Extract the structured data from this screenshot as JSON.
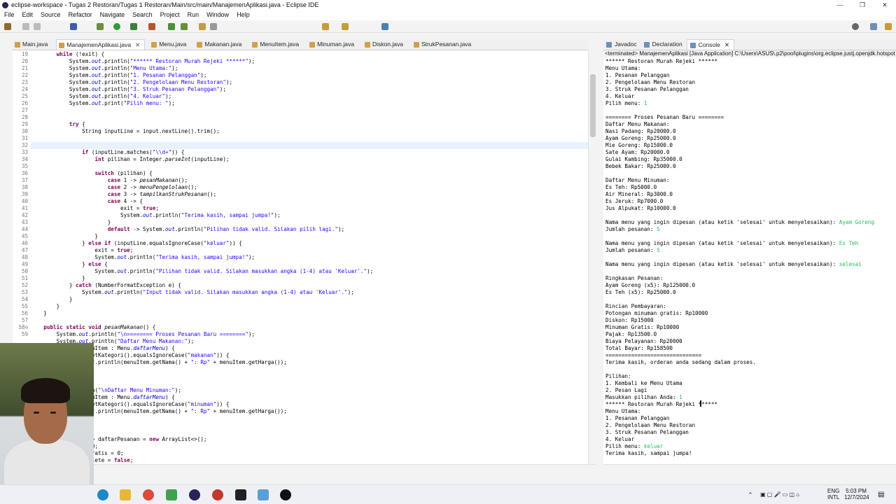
{
  "window": {
    "title": "eclipse-workspace - Tugas 2 Restoran/Tugas 1 Restoran/Main/src/main/ManajemenAplikasi.java - Eclipse IDE",
    "controls": [
      "—",
      "❐",
      "✕"
    ]
  },
  "menubar": [
    "File",
    "Edit",
    "Source",
    "Refactor",
    "Navigate",
    "Search",
    "Project",
    "Run",
    "Window",
    "Help"
  ],
  "editor_tabs": [
    {
      "label": "Main.java",
      "active": false
    },
    {
      "label": "ManajemenAplikasi.java",
      "active": true
    },
    {
      "label": "Menu.java",
      "active": false
    },
    {
      "label": "Makanan.java",
      "active": false
    },
    {
      "label": "MenuItem.java",
      "active": false
    },
    {
      "label": "Minuman.java",
      "active": false
    },
    {
      "label": "Diskon.java",
      "active": false
    },
    {
      "label": "StrukPesanan.java",
      "active": false
    }
  ],
  "code_lines": [
    {
      "n": "19",
      "t": "        while (!exit) {"
    },
    {
      "n": "20",
      "t": "            System.out.println(\"****** Restoran Murah Rejeki ******\");"
    },
    {
      "n": "21",
      "t": "            System.out.println(\"Menu Utama:\");"
    },
    {
      "n": "22",
      "t": "            System.out.println(\"1. Pesanan Pelanggan\");"
    },
    {
      "n": "23",
      "t": "            System.out.println(\"2. Pengelolaan Menu Restoran\");"
    },
    {
      "n": "24",
      "t": "            System.out.println(\"3. Struk Pesanan Pelanggan\");"
    },
    {
      "n": "25",
      "t": "            System.out.println(\"4. Keluar\");"
    },
    {
      "n": "26",
      "t": "            System.out.print(\"Pilih menu: \");"
    },
    {
      "n": "27",
      "t": ""
    },
    {
      "n": "28",
      "t": ""
    },
    {
      "n": "29",
      "t": "            try {"
    },
    {
      "n": "30",
      "t": "                String inputLine = input.nextLine().trim();"
    },
    {
      "n": "31",
      "t": ""
    },
    {
      "n": "32",
      "t": ""
    },
    {
      "n": "33",
      "t": "                if (inputLine.matches(\"\\\\d+\")) {"
    },
    {
      "n": "34",
      "t": "                    int pilihan = Integer.parseInt(inputLine);"
    },
    {
      "n": "35",
      "t": ""
    },
    {
      "n": "36",
      "t": "                    switch (pilihan) {"
    },
    {
      "n": "37",
      "t": "                        case 1 -> pesanMakanan();"
    },
    {
      "n": "38",
      "t": "                        case 2 -> menuPengelolaan();"
    },
    {
      "n": "39",
      "t": "                        case 3 -> tampilkanStrukPesanan();"
    },
    {
      "n": "40",
      "t": "                        case 4 -> {"
    },
    {
      "n": "41",
      "t": "                            exit = true;"
    },
    {
      "n": "42",
      "t": "                            System.out.println(\"Terima kasih, sampai jumpa!\");"
    },
    {
      "n": "43",
      "t": "                        }"
    },
    {
      "n": "44",
      "t": "                        default -> System.out.println(\"Pilihan tidak valid. Silakan pilih lagi.\");"
    },
    {
      "n": "45",
      "t": "                    }"
    },
    {
      "n": "46",
      "t": "                } else if (inputLine.equalsIgnoreCase(\"keluar\")) {"
    },
    {
      "n": "47",
      "t": "                    exit = true;"
    },
    {
      "n": "48",
      "t": "                    System.out.println(\"Terima kasih, sampai jumpa!\");"
    },
    {
      "n": "49",
      "t": "                } else {"
    },
    {
      "n": "50",
      "t": "                    System.out.println(\"Pilihan tidak valid. Silakan masukkan angka (1-4) atau 'Keluar'.\");"
    },
    {
      "n": "51",
      "t": "                }"
    },
    {
      "n": "52",
      "t": "            } catch (NumberFormatException e) {"
    },
    {
      "n": "53",
      "t": "                System.out.println(\"Input tidak valid. Silakan masukkan angka (1-4) atau 'Keluar'.\");"
    },
    {
      "n": "54",
      "t": "            }"
    },
    {
      "n": "55",
      "t": "        }"
    },
    {
      "n": "56",
      "t": "    }"
    },
    {
      "n": "57",
      "t": ""
    },
    {
      "n": "58⊖",
      "t": "    public static void pesanMakanan() {"
    },
    {
      "n": "59",
      "t": "        System.out.println(\"\\n======== Proses Pesanan Baru ========\");"
    },
    {
      "n": "",
      "t": "        System.out.println(\"Daftar Menu Makanan:\");"
    },
    {
      "n": "",
      "t": "            tem menuItem : Menu.daftarMenu) {"
    },
    {
      "n": "",
      "t": "            uItem.getKategori().equalsIgnoreCase(\"makanan\")) {"
    },
    {
      "n": "",
      "t": "            stem.out.println(menuItem.getNama() + \": Rp\" + menuItem.getHarga());"
    },
    {
      "n": "",
      "t": ""
    },
    {
      "n": "",
      "t": ""
    },
    {
      "n": "",
      "t": ""
    },
    {
      "n": "",
      "t": "            .println(\"\\nDaftar Menu Minuman:\");"
    },
    {
      "n": "",
      "t": "            tem menuItem : Menu.daftarMenu) {"
    },
    {
      "n": "",
      "t": "            uItem.getKategori().equalsIgnoreCase(\"minuman\")) {"
    },
    {
      "n": "",
      "t": "            stem.out.println(menuItem.getNama() + \": Rp\" + menuItem.getHarga());"
    },
    {
      "n": "",
      "t": ""
    },
    {
      "n": "",
      "t": ""
    },
    {
      "n": "",
      "t": ""
    },
    {
      "n": "",
      "t": "            Pesanan> daftarPesanan = new ArrayList<>();"
    },
    {
      "n": "",
      "t": "            arga = 0;"
    },
    {
      "n": "",
      "t": "            inumanGratis = 0;"
    },
    {
      "n": "",
      "t": "            derComplete = false;"
    }
  ],
  "console_tabs": [
    {
      "label": "Javadoc",
      "active": false
    },
    {
      "label": "Declaration",
      "active": false
    },
    {
      "label": "Console",
      "active": true
    }
  ],
  "console_terminated": "<terminated> ManajemenAplikasi [Java Application] C:\\Users\\ASUS\\.p2\\pool\\plugins\\org.eclipse.justj.openjdk.hotspot",
  "console_lines": [
    {
      "t": "****** Restoran Murah Rejeki ******"
    },
    {
      "t": "Menu Utama:"
    },
    {
      "t": "1. Pesanan Pelanggan"
    },
    {
      "t": "2. Pengelolaan Menu Restoran"
    },
    {
      "t": "3. Struk Pesanan Pelanggan"
    },
    {
      "t": "4. Keluar"
    },
    {
      "t": "Pilih menu: ",
      "in": "1"
    },
    {
      "t": ""
    },
    {
      "t": "======== Proses Pesanan Baru ========"
    },
    {
      "t": "Daftar Menu Makanan:"
    },
    {
      "t": "Nasi Padang: Rp20000.0"
    },
    {
      "t": "Ayam Goreng: Rp25000.0"
    },
    {
      "t": "Mie Goreng: Rp15000.0"
    },
    {
      "t": "Sate Ayam: Rp20000.0"
    },
    {
      "t": "Gulai Kambing: Rp35000.0"
    },
    {
      "t": "Bebek Bakar: Rp25000.0"
    },
    {
      "t": ""
    },
    {
      "t": "Daftar Menu Minuman:"
    },
    {
      "t": "Es Teh: Rp5000.0"
    },
    {
      "t": "Air Mineral: Rp3000.0"
    },
    {
      "t": "Es Jeruk: Rp7000.0"
    },
    {
      "t": "Jus Alpukat: Rp10000.0"
    },
    {
      "t": ""
    },
    {
      "t": "Nama menu yang ingin dipesan (atau ketik 'selesai' untuk menyelesaikan): ",
      "in": "Ayam Goreng"
    },
    {
      "t": "Jumlah pesanan: ",
      "in": "5"
    },
    {
      "t": ""
    },
    {
      "t": "Nama menu yang ingin dipesan (atau ketik 'selesai' untuk menyelesaikan): ",
      "in": "Es Teh"
    },
    {
      "t": "Jumlah pesanan: ",
      "in": "5"
    },
    {
      "t": ""
    },
    {
      "t": "Nama menu yang ingin dipesan (atau ketik 'selesai' untuk menyelesaikan): ",
      "in": "selesai"
    },
    {
      "t": ""
    },
    {
      "t": "Ringkasan Pesanan:"
    },
    {
      "t": "Ayam Goreng (x5): Rp125000.0"
    },
    {
      "t": "Es Teh (x5): Rp25000.0"
    },
    {
      "t": ""
    },
    {
      "t": "Rincian Pembayaran:"
    },
    {
      "t": "Potongan minuman gratis: Rp10000"
    },
    {
      "t": "Diskon: Rp15000"
    },
    {
      "t": "Minuman Gratis: Rp10000"
    },
    {
      "t": "Pajak: Rp13500.0"
    },
    {
      "t": "Biaya Pelayanan: Rp20000"
    },
    {
      "t": "Total Bayar: Rp158500"
    },
    {
      "t": "=============================="
    },
    {
      "t": "Terima kasih, orderan anda sedang dalam proses."
    },
    {
      "t": ""
    },
    {
      "t": "Pilihan:"
    },
    {
      "t": "1. Kembali ke Menu Utama"
    },
    {
      "t": "2. Pesan Lagi"
    },
    {
      "t": "Masukkan pilihan Anda: ",
      "in": "1"
    },
    {
      "t": "****** Restoran Murah Rejeki ******"
    },
    {
      "t": "Menu Utama:"
    },
    {
      "t": "1. Pesanan Pelanggan"
    },
    {
      "t": "2. Pengelolaan Menu Restoran"
    },
    {
      "t": "3. Struk Pesanan Pelanggan"
    },
    {
      "t": "4. Keluar"
    },
    {
      "t": "Pilih menu: ",
      "in": "keluar"
    },
    {
      "t": "Terima kasih, sampai jumpa!"
    }
  ],
  "taskbar": {
    "lang": "ENG",
    "lang2": "INTL",
    "time": "5:03 PM",
    "date": "12/7/2024"
  },
  "colors": {
    "keyword": "#7f0055",
    "string": "#2a00ff",
    "field": "#0000c0",
    "console_input": "#1fbf5a"
  }
}
